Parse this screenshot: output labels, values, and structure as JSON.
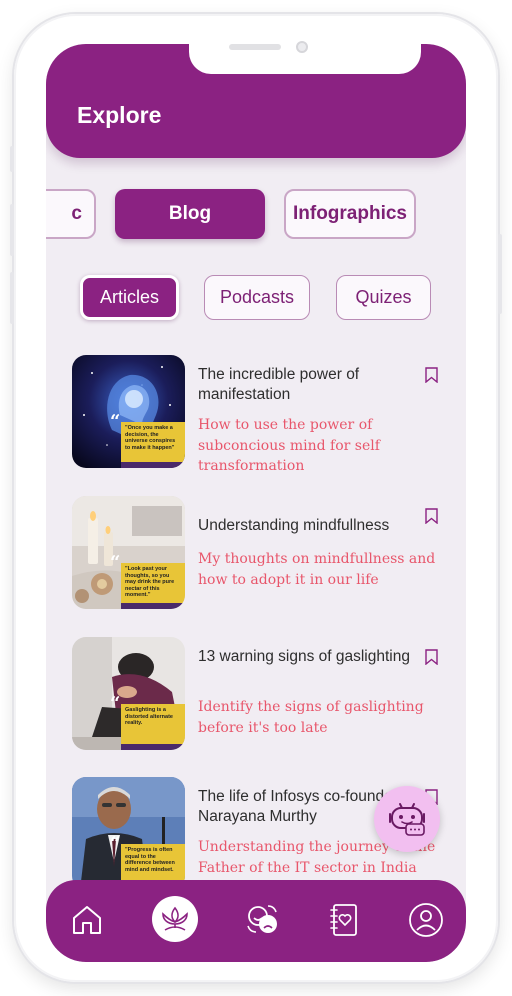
{
  "header": {
    "title": "Explore"
  },
  "categories": [
    {
      "label": "c",
      "active": false
    },
    {
      "label": "Blog",
      "active": true
    },
    {
      "label": "Infographics",
      "active": false
    }
  ],
  "subtabs": [
    {
      "label": "Articles",
      "active": true
    },
    {
      "label": "Podcasts",
      "active": false
    },
    {
      "label": "Quizes",
      "active": false
    }
  ],
  "articles": [
    {
      "title": "The incredible power of manifestation",
      "description": "How to use the power of subconcious mind for self transformation",
      "quote": "\"Once you make a decision, the universe conspires to make it happen\""
    },
    {
      "title": "Understanding mindfullness",
      "description": "My thoughts on mindfullness and how to adopt it in our life",
      "quote": "\"Look past your thoughts, so you may drink the pure nectar of this moment.\""
    },
    {
      "title": "13 warning signs of gaslighting",
      "description": "Identify the signs of gaslighting before it's too late",
      "quote": "Gaslighting is a distorted alternate reality."
    },
    {
      "title": "The life of Infosys co-founder Narayana Murthy",
      "description": "Understanding the journey of the Father of the IT sector in India",
      "quote": "\"Progress is often equal to the difference between mind and mindset."
    }
  ],
  "nav": {
    "items": [
      "home-icon",
      "meditation-icon",
      "mood-icon",
      "journal-icon",
      "profile-icon"
    ],
    "active_index": 1
  },
  "colors": {
    "primary": "#8b2282",
    "background": "#f1edf3",
    "accent_text": "#e8566b",
    "fab": "#f2bff0"
  }
}
